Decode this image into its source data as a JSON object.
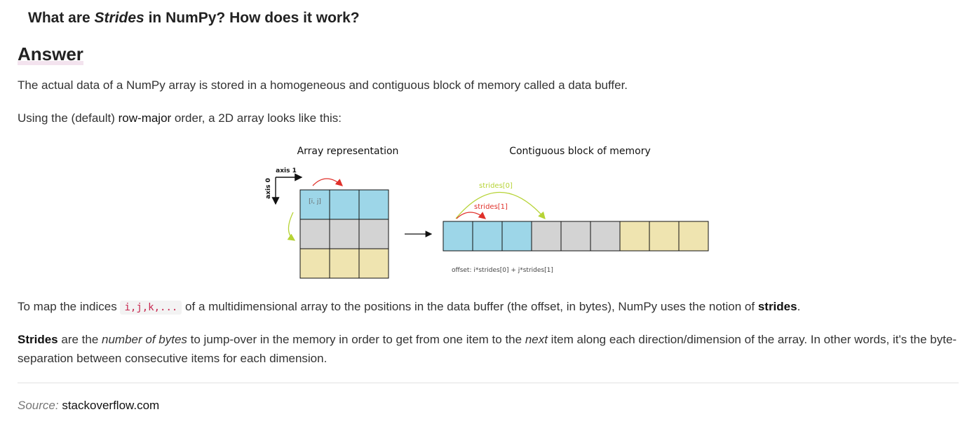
{
  "question": {
    "prefix": "What are ",
    "emphasis": "Strides",
    "suffix": " in NumPy? How does it work?"
  },
  "answer_heading": "Answer",
  "paragraph1": "The actual data of a NumPy array is stored in a homogeneous and contiguous block of memory called a data buffer.",
  "paragraph2": {
    "before": "Using the (default) ",
    "term": "row-major",
    "after": " order, a 2D array looks like this:"
  },
  "diagram": {
    "array_title": "Array representation",
    "memory_title": "Contiguous block of memory",
    "axis1_label": "axis 1",
    "axis0_label": "axis 0",
    "cell_label": "[i, j]",
    "strides0_label": "strides[0]",
    "strides1_label": "strides[1]",
    "offset_formula": "offset: i*strides[0] + j*strides[1]",
    "colors": {
      "row0": "#9dd6e8",
      "row1": "#d3d3d3",
      "row2": "#efe4b0",
      "arrow_red": "#e0302a",
      "arrow_green": "#b6d335"
    }
  },
  "paragraph3": {
    "before": "To map the indices ",
    "code": "i,j,k,...",
    "middle": " of a multidimensional array to the positions in the data buffer (the offset, in bytes), NumPy uses the notion of ",
    "term": "strides",
    "after": "."
  },
  "paragraph4": {
    "term": "Strides",
    "part1": " are the ",
    "emphasis1": "number of bytes",
    "part2": " to jump-over in the memory in order to get from one item to the ",
    "emphasis2": "next",
    "part3": " item along each direction/dimension of the array. In other words, it's the byte-separation between consecutive items for each dimension."
  },
  "source": {
    "label": "Source:",
    "site": "stackoverflow.com"
  }
}
